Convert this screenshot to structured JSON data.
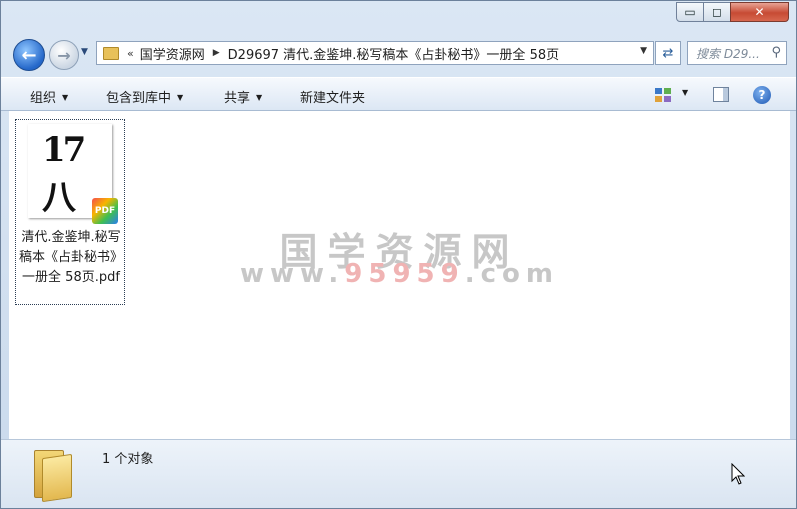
{
  "window": {
    "controls": {
      "minimize": "▭",
      "maximize": "◻",
      "close": "✕"
    }
  },
  "nav": {
    "address_prefix": "«",
    "crumbs": [
      "国学资源网",
      "D29697 清代.金鉴坤.秘写稿本《占卦秘书》一册全 58页"
    ],
    "search_placeholder": "搜索 D29..."
  },
  "toolbar": {
    "organize": "组织",
    "include_in_library": "包含到库中",
    "share": "共享",
    "new_folder": "新建文件夹"
  },
  "files": [
    {
      "name": "清代.金鉴坤.秘写稿本《占卦秘书》一册全 58页.pdf",
      "type_badge": "PDF",
      "thumb_text": "17八"
    }
  ],
  "watermark": {
    "line1": "国学资源网",
    "line2_pre": "www.",
    "line2_red": "95959",
    "line2_post": ".com"
  },
  "status": {
    "count_text": "1 个对象"
  },
  "icons": {
    "back": "back-arrow-icon",
    "forward": "forward-arrow-icon",
    "refresh": "refresh-icon",
    "search": "search-icon",
    "help": "help-icon"
  }
}
